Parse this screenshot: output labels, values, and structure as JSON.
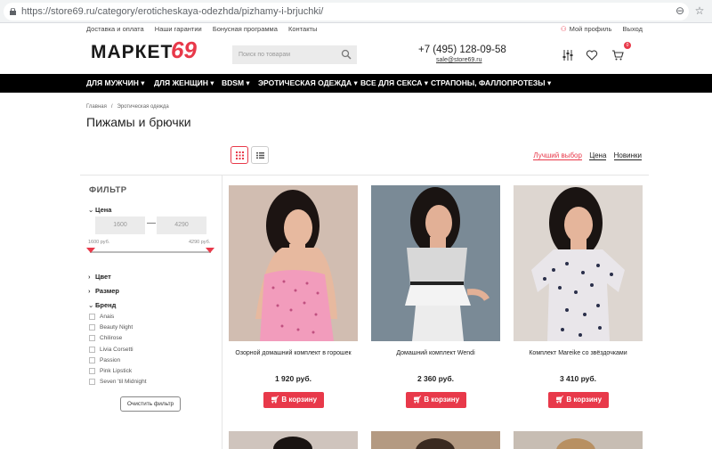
{
  "browser": {
    "url": "https://store69.ru/category/eroticheskaya-odezhda/pizhamy-i-brjuchki/"
  },
  "topnav": [
    "Доставка и оплата",
    "Наши гарантии",
    "Бонусная программа",
    "Контакты"
  ],
  "user": {
    "profile": "Мой профиль",
    "logout": "Выход"
  },
  "logo": {
    "word": "МАРКЕТ",
    "num": "69"
  },
  "search": {
    "placeholder": "Поиск по товарам"
  },
  "contacts": {
    "phone": "+7 (495) 128-09-58",
    "email": "sale@store69.ru"
  },
  "cart": {
    "count": "0"
  },
  "mainnav": [
    "ДЛЯ МУЖЧИН ▾",
    "ДЛЯ ЖЕНЩИН ▾",
    "BDSM ▾",
    "ЭРОТИЧЕСКАЯ ОДЕЖДА ▾",
    "ВСЕ ДЛЯ СЕКСА ▾",
    "СТРАПОНЫ, ФАЛЛОПРОТЕЗЫ ▾"
  ],
  "breadcrumb": [
    "Главная",
    "/",
    "Эротическая одежда"
  ],
  "page": {
    "title": "Пижамы и брючки"
  },
  "sort": {
    "best": "Лучший выбор",
    "price": "Цена",
    "new": "Новинки"
  },
  "filter": {
    "title": "ФИЛЬТР",
    "price_label": "Цена",
    "min": "1600",
    "max": "4290",
    "min_label": "1600 руб.",
    "max_label": "4290 руб.",
    "color": "Цвет",
    "size": "Размер",
    "brand": "Бренд",
    "brands": [
      "Anais",
      "Beauty Night",
      "Chilirose",
      "Livia Corsetti",
      "Passion",
      "Pink Lipstick",
      "Seven 'til Midnight"
    ],
    "clear": "Очистить фильтр"
  },
  "products": [
    {
      "name": "Озорной домашний комплект в горошек",
      "price": "1 920 руб.",
      "buy": "В корзину"
    },
    {
      "name": "Домашний комплект Wendi",
      "price": "2 360 руб.",
      "buy": "В корзину"
    },
    {
      "name": "Комплект Mareike со звёздочками",
      "price": "3 410 руб.",
      "buy": "В корзину"
    }
  ],
  "colors": {
    "accent": "#e8394a",
    "nav": "#000000"
  }
}
